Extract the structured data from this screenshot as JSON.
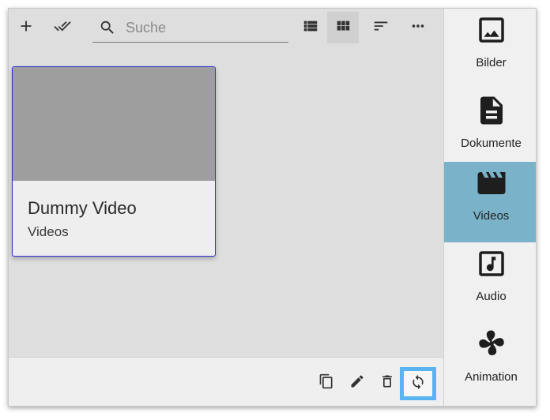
{
  "toolbar": {
    "add_icon": "plus-icon",
    "select_all_icon": "double-check-icon",
    "search_placeholder": "Suche",
    "search_value": "",
    "list_view_icon": "list-view-icon",
    "grid_view_icon": "grid-view-icon",
    "sort_icon": "sort-icon",
    "more_icon": "more-horizontal-icon"
  },
  "cards": [
    {
      "title": "Dummy Video",
      "subtitle": "Videos"
    }
  ],
  "bottombar": {
    "copy_icon": "copy-icon",
    "edit_icon": "pencil-icon",
    "delete_icon": "trash-icon",
    "refresh_icon": "sync-icon"
  },
  "sidebar": {
    "items": [
      {
        "label": "Bilder",
        "icon": "image-icon"
      },
      {
        "label": "Dokumente",
        "icon": "document-icon"
      },
      {
        "label": "Videos",
        "icon": "clapperboard-icon",
        "active": true
      },
      {
        "label": "Audio",
        "icon": "music-note-icon"
      },
      {
        "label": "Animation",
        "icon": "pinwheel-icon"
      }
    ]
  },
  "colors": {
    "active_sidebar": "#7ab3c9",
    "focus_outline": "#5ab4f2",
    "card_border": "#2b2bd6"
  }
}
